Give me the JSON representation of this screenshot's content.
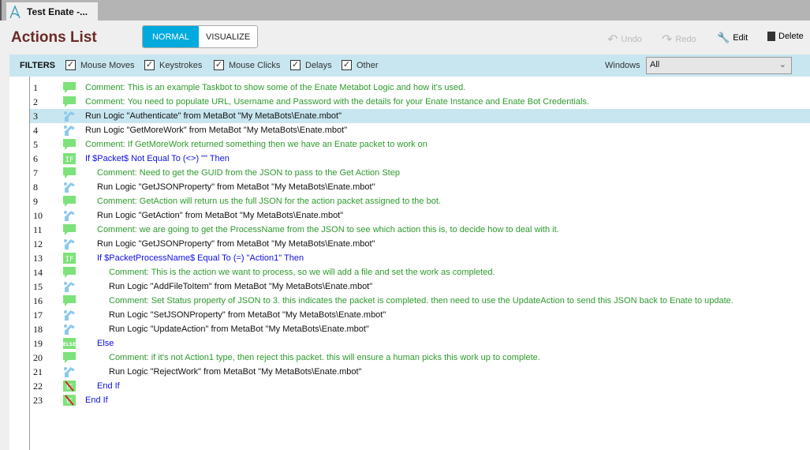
{
  "tab": {
    "title": "Test Enate -..."
  },
  "header": {
    "title": "Actions List",
    "normal": "NORMAL",
    "visualize": "VISUALIZE",
    "undo": "Undo",
    "redo": "Redo",
    "edit": "Edit",
    "delete": "Delete"
  },
  "filters": {
    "label": "FILTERS",
    "items": [
      "Mouse Moves",
      "Keystrokes",
      "Mouse Clicks",
      "Delays",
      "Other"
    ],
    "windows_label": "Windows",
    "windows_value": "All"
  },
  "rows": [
    {
      "n": "1",
      "type": "comment",
      "indent": 0,
      "text": "Comment: This is an example Taskbot to show some of the Enate Metabot Logic and how it's used."
    },
    {
      "n": "2",
      "type": "comment",
      "indent": 0,
      "text": "Comment:  You need to populate URL, Username and Password with the details for your Enate Instance and Enate Bot Credentials."
    },
    {
      "n": "3",
      "type": "run",
      "indent": 0,
      "text": "Run Logic \"Authenticate\" from MetaBot \"My MetaBots\\Enate.mbot\"",
      "selected": true
    },
    {
      "n": "4",
      "type": "run",
      "indent": 0,
      "text": "Run Logic \"GetMoreWork\" from MetaBot \"My MetaBots\\Enate.mbot\""
    },
    {
      "n": "5",
      "type": "comment",
      "indent": 0,
      "text": "Comment: If GetMoreWork returned something then we have an Enate packet to work on"
    },
    {
      "n": "6",
      "type": "if",
      "indent": 0,
      "text": "If $Packet$ Not Equal To (<>) \"\" Then"
    },
    {
      "n": "7",
      "type": "comment",
      "indent": 1,
      "text": "Comment: Need to get the GUID from the JSON to pass to the Get Action Step"
    },
    {
      "n": "8",
      "type": "run",
      "indent": 1,
      "text": "Run Logic \"GetJSONProperty\" from MetaBot \"My MetaBots\\Enate.mbot\""
    },
    {
      "n": "9",
      "type": "comment",
      "indent": 1,
      "text": "Comment: GetAction will return us the full JSON for the action packet assigned to the bot."
    },
    {
      "n": "10",
      "type": "run",
      "indent": 1,
      "text": "Run Logic \"GetAction\" from MetaBot \"My MetaBots\\Enate.mbot\""
    },
    {
      "n": "11",
      "type": "comment",
      "indent": 1,
      "text": "Comment: we are going to get the ProcessName from the JSON to see which action this is, to decide how to deal with it."
    },
    {
      "n": "12",
      "type": "run",
      "indent": 1,
      "text": "Run Logic \"GetJSONProperty\" from MetaBot \"My MetaBots\\Enate.mbot\""
    },
    {
      "n": "13",
      "type": "if",
      "indent": 1,
      "text": "If $PacketProcessName$ Equal To (=) \"Action1\" Then"
    },
    {
      "n": "14",
      "type": "comment",
      "indent": 2,
      "text": "Comment: This is the action we want to process, so we will add a file and set the work as completed."
    },
    {
      "n": "15",
      "type": "run",
      "indent": 2,
      "text": "Run Logic \"AddFileToItem\" from MetaBot \"My MetaBots\\Enate.mbot\""
    },
    {
      "n": "16",
      "type": "comment",
      "indent": 2,
      "text": "Comment: Set Status property of JSON to 3.  this indicates the packet is completed.  then need to use the UpdateAction to send this JSON back to Enate to update."
    },
    {
      "n": "17",
      "type": "run",
      "indent": 2,
      "text": "Run Logic \"SetJSONProperty\" from MetaBot \"My MetaBots\\Enate.mbot\""
    },
    {
      "n": "18",
      "type": "run",
      "indent": 2,
      "text": "Run Logic \"UpdateAction\" from MetaBot \"My MetaBots\\Enate.mbot\""
    },
    {
      "n": "19",
      "type": "else",
      "indent": 1,
      "text": "Else"
    },
    {
      "n": "20",
      "type": "comment",
      "indent": 2,
      "text": "Comment: if it's not Action1 type, then reject this packet.  this will ensure a human picks this work up to complete."
    },
    {
      "n": "21",
      "type": "run",
      "indent": 2,
      "text": "Run Logic \"RejectWork\" from MetaBot \"My MetaBots\\Enate.mbot\""
    },
    {
      "n": "22",
      "type": "endif",
      "indent": 1,
      "text": "End If"
    },
    {
      "n": "23",
      "type": "endif",
      "indent": 0,
      "text": "End If"
    }
  ]
}
